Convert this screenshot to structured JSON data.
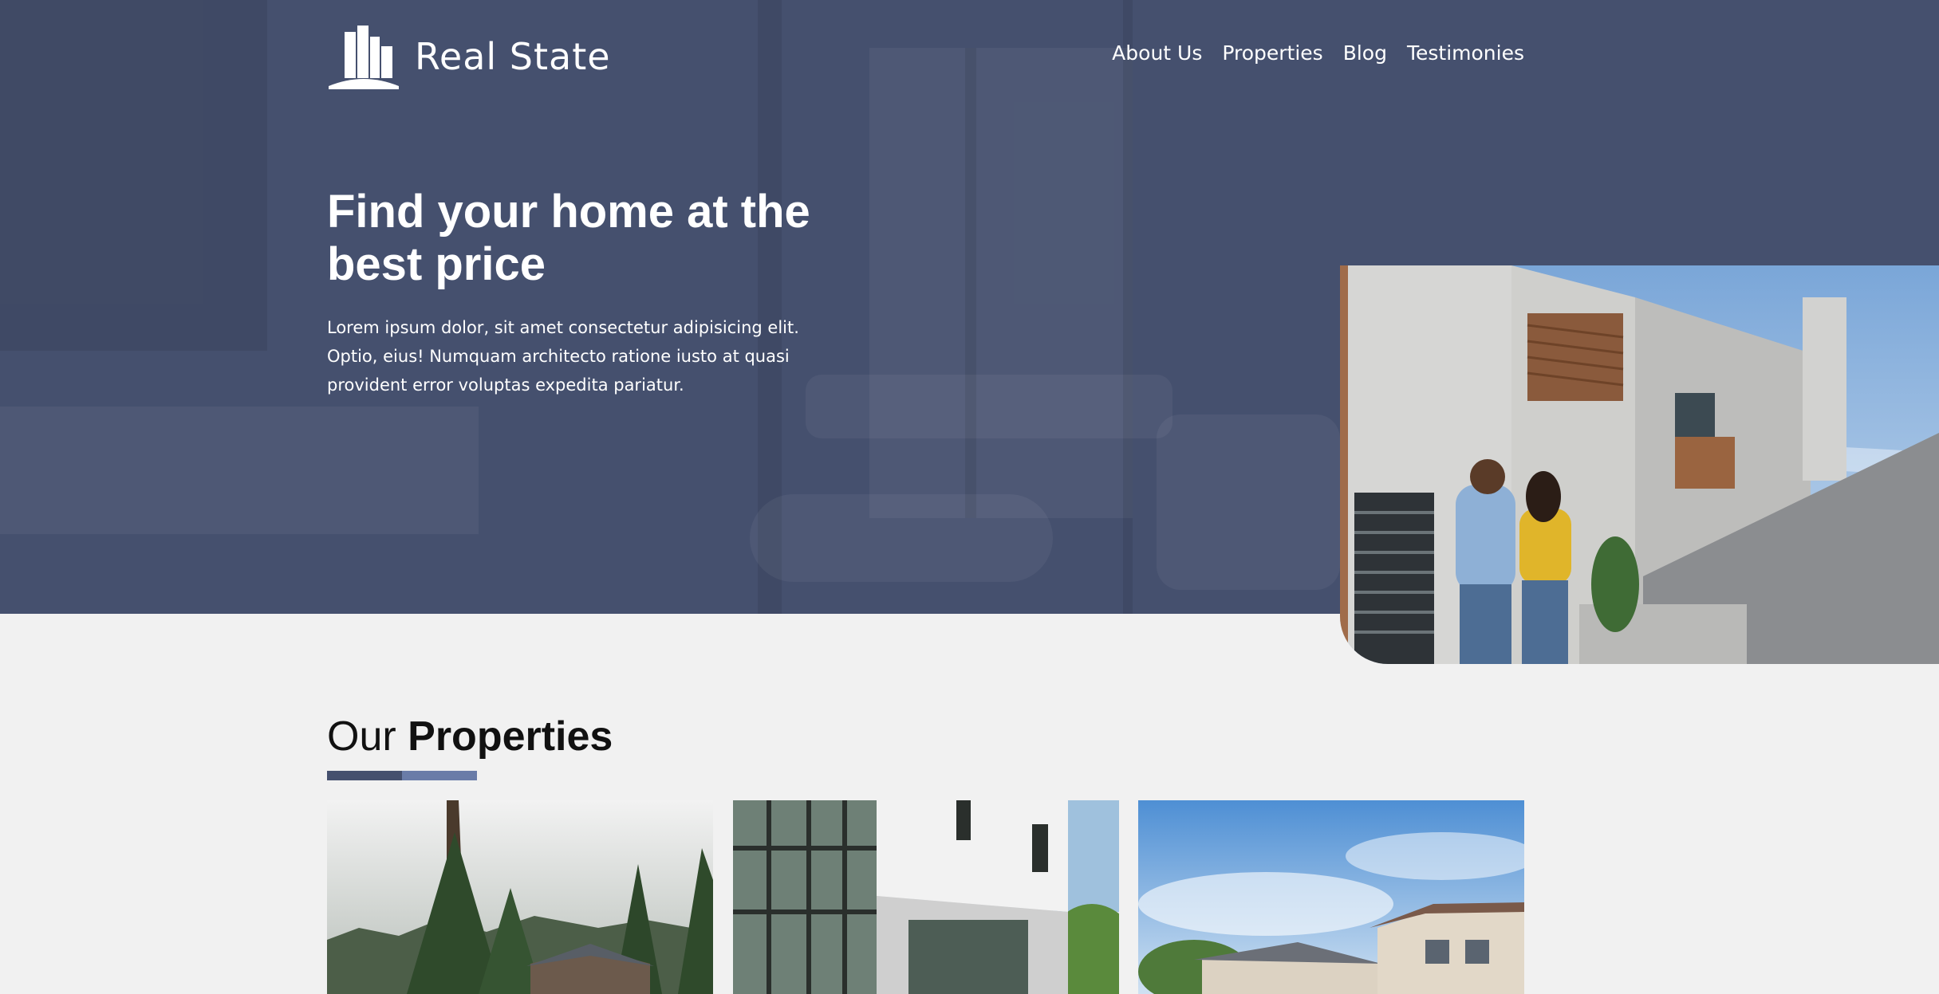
{
  "brand": {
    "name": "Real State"
  },
  "nav": {
    "items": [
      {
        "label": "About Us"
      },
      {
        "label": "Properties"
      },
      {
        "label": "Blog"
      },
      {
        "label": "Testimonies"
      }
    ]
  },
  "hero": {
    "title": "Find your home at the best price",
    "text": "Lorem ipsum dolor, sit amet consectetur adipisicing elit. Optio, eius! Numquam architecto ratione iusto at quasi provident error voluptas expedita pariatur."
  },
  "properties": {
    "title_light": "Our",
    "title_bold": "Properties"
  },
  "colors": {
    "hero_bg": "#45506e",
    "accent_dark": "#45506e",
    "accent_light": "#6a7ca8",
    "page_bg": "#f1f1f1"
  }
}
